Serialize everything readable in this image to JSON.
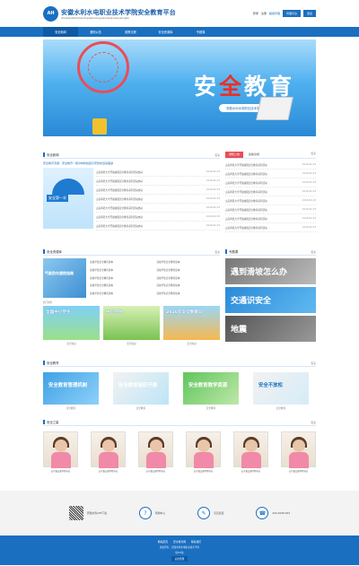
{
  "header": {
    "title": "安徽水利水电职业技术学院安全教育平台",
    "subtitle": "anhuishuilishuidianzhiyejishuxueyuananquanjiaoyupingtai",
    "login_link": "登录",
    "register_link": "注册",
    "user_name": "超级管理",
    "btn_manage": "管理平台",
    "btn_exit": "退出"
  },
  "nav": [
    "安全新闻",
    "通知公告",
    "政策法规",
    "安全资源库",
    "专题课"
  ],
  "banner": {
    "title_a": "安",
    "title_b": "全",
    "title_c": "教育",
    "slogan": "安徽水利水电职业技术学院安全教育平台"
  },
  "news": {
    "title": "安全新闻",
    "more": "更多",
    "headline": "安全教育专题：安全教育一把伞构筑校园平安防线活动事迹",
    "image_caption": "安全第一伞",
    "items": [
      {
        "t": "山东师范大学开展校园安全教育系列活动启动",
        "d": "2016-02-23"
      },
      {
        "t": "山东师范大学开展校园安全教育系列活动启动",
        "d": "2016-02-23"
      },
      {
        "t": "山东师范大学开展校园安全教育系列活动启动",
        "d": "2016-02-23"
      },
      {
        "t": "山东师范大学开展校园安全教育系列活动启动",
        "d": "2016-02-23"
      },
      {
        "t": "山东师范大学开展校园安全教育系列活动启动",
        "d": "2016-02-23"
      },
      {
        "t": "山东师范大学开展校园安全教育系列活动启动",
        "d": "2016-02-23"
      },
      {
        "t": "山东师范大学开展校园安全教育系列活动启动",
        "d": "2016-02-23"
      }
    ]
  },
  "notice": {
    "tab1": "通知公告",
    "tab2": "政策法规",
    "more": "更多",
    "items": [
      {
        "t": "山东师范大学开展校园安全教育系列活动",
        "d": "2016-02-23"
      },
      {
        "t": "山东师范大学开展校园安全教育系列活动",
        "d": "2016-02-23"
      },
      {
        "t": "山东师范大学开展校园安全教育系列活动",
        "d": "2016-02-23"
      },
      {
        "t": "山东师范大学开展校园安全教育系列活动",
        "d": "2016-02-23"
      },
      {
        "t": "山东师范大学开展校园安全教育系列活动",
        "d": "2016-02-23"
      },
      {
        "t": "山东师范大学开展校园安全教育系列活动",
        "d": "2016-02-23"
      },
      {
        "t": "山东师范大学开展校园安全教育系列活动",
        "d": "2016-02-23"
      },
      {
        "t": "山东师范大学开展校园安全教育系列活动",
        "d": "2016-02-23"
      }
    ]
  },
  "resources": {
    "title": "安全资源库",
    "more": "更多",
    "weather_caption": "气象防灾避险指南",
    "sub_label": "热门推荐",
    "items": [
      "高校学生安全教育读本",
      "高校学生安全教育读本",
      "高校学生安全教育读本",
      "高校学生安全教育读本",
      "高校学生安全教育读本",
      "高校学生安全教育读本",
      "高校学生安全教育读本",
      "高校学生安全教育读本",
      "高校学生安全教育读本",
      "高校学生安全教育读本"
    ],
    "pics": [
      {
        "cap": "全国中小学生",
        "lbl": "安全知识"
      },
      {
        "cap": "中小学生",
        "lbl": "安全知识"
      },
      {
        "cap": "2016年安全教育日",
        "lbl": "安全知识"
      }
    ]
  },
  "topics": {
    "title": "专题课",
    "more": "更多",
    "items": [
      "遇到滑坡怎么办",
      "交通识安全",
      "地震"
    ]
  },
  "education": {
    "title": "安全教育",
    "more": "更多",
    "cards": [
      {
        "cap": "安全教育管理机制",
        "lbl": "安全教育"
      },
      {
        "cap": "安全教育组织开展",
        "lbl": "安全教育"
      },
      {
        "cap": "安全教育教学资源",
        "lbl": "安全教育"
      },
      {
        "cap": "安全不放松",
        "lbl": "安全教育"
      }
    ]
  },
  "stars": {
    "title": "安全之星",
    "more": "更多",
    "items": [
      "山东省交通学院标兵",
      "山东省交通学院标兵",
      "山东省交通学院标兵",
      "山东省交通学院标兵",
      "山东省交通学院标兵",
      "山东省交通学院标兵"
    ]
  },
  "footer_icons": {
    "app": "安徽水利APP下载",
    "help": "帮助中心",
    "feedback": "意见反馈",
    "phone": "400-0098-663"
  },
  "footer": {
    "links": [
      "网站首页",
      "安全教育网",
      "联系我们"
    ],
    "line1": "版权所有：安徽水利水电职业技术学院",
    "line2": "皖ICP备",
    "btn": "后台管理"
  }
}
